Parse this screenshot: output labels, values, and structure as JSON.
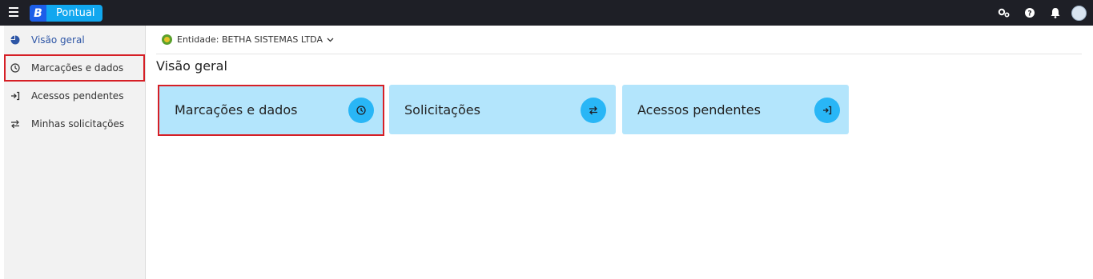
{
  "app": {
    "brand_letter": "B",
    "name": "Pontual"
  },
  "topbar": {
    "icons": [
      "gears-icon",
      "help-icon",
      "bell-icon",
      "user-avatar"
    ]
  },
  "sidebar": {
    "items": [
      {
        "label": "Visão geral",
        "icon": "pie-chart-icon",
        "active": true
      },
      {
        "label": "Marcações e dados",
        "icon": "clock-icon"
      },
      {
        "label": "Acessos pendentes",
        "icon": "sign-in-icon"
      },
      {
        "label": "Minhas solicitações",
        "icon": "swap-icon"
      }
    ]
  },
  "main": {
    "entity_label": "Entidade: BETHA SISTEMAS LTDA",
    "title": "Visão geral",
    "cards": [
      {
        "label": "Marcações e dados",
        "icon": "clock-icon"
      },
      {
        "label": "Solicitações",
        "icon": "swap-icon"
      },
      {
        "label": "Acessos pendentes",
        "icon": "sign-in-icon"
      }
    ]
  },
  "colors": {
    "topbar": "#1e1f26",
    "card_bg": "#b3e5fc",
    "card_icon_bg": "#29b6f6",
    "brand": "#11a7ef",
    "highlight": "#d61f26",
    "active_text": "#2e56a6"
  }
}
